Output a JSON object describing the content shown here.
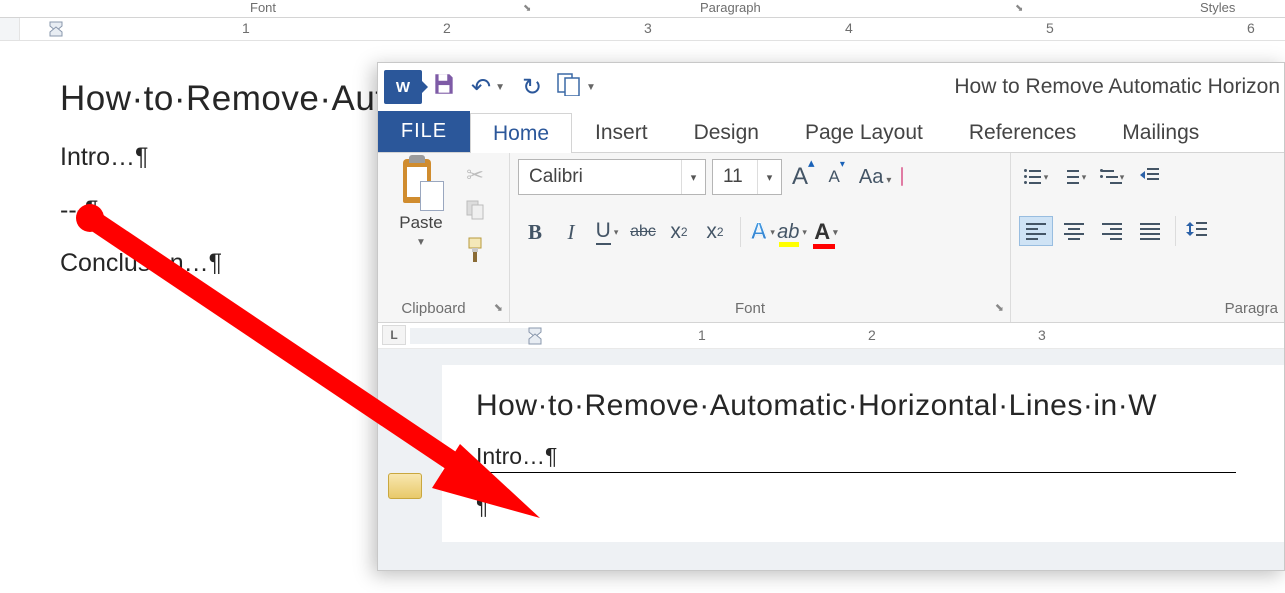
{
  "bg": {
    "groups": {
      "font": "Font",
      "paragraph": "Paragraph",
      "styles": "Styles",
      "launcher": "⬊"
    },
    "ruler": {
      "n1": "1",
      "n2": "2",
      "n3": "3",
      "n4": "4",
      "n5": "5",
      "n6": "6"
    },
    "doc": {
      "title": "How·to·Remove·Auto",
      "intro": "Intro…¶",
      "dashes": "---¶",
      "conclusion": "Conclusion…¶"
    }
  },
  "fg": {
    "qat": {
      "word_badge": "W",
      "save": "💾",
      "undo": "↶",
      "redo": "↻",
      "newdoc": "🗐",
      "title": "How to Remove Automatic Horizon"
    },
    "tabs": {
      "file": "FILE",
      "home": "Home",
      "insert": "Insert",
      "design": "Design",
      "page_layout": "Page Layout",
      "references": "References",
      "mailings": "Mailings"
    },
    "clipboard": {
      "paste": "Paste",
      "label": "Clipboard",
      "cut": "✂",
      "copy_icon": "⧉",
      "painter": "🖌"
    },
    "font": {
      "name": "Calibri",
      "size": "11",
      "grow": "A",
      "shrink": "A",
      "case": "Aa",
      "clear_icon": "eraser",
      "bold": "B",
      "italic": "I",
      "underline": "U",
      "strike": "abc",
      "sub": "x",
      "sub2": "2",
      "sup": "x",
      "sup2": "2",
      "effects": "A",
      "highlight_pen": "ab",
      "color": "A",
      "label": "Font"
    },
    "paragraph": {
      "label": "Paragra",
      "bullets": "bullets",
      "numbering": "numbering",
      "multilevel": "multilevel",
      "dec_indent": "⇤",
      "inc_indent": "⇥",
      "align_left": "al",
      "align_center": "ac",
      "align_right": "ar",
      "justify": "aj",
      "spacing": "‡≡"
    },
    "ruler": {
      "tabwell": "L",
      "n1": "1",
      "n2": "2",
      "n3": "3"
    },
    "doc": {
      "title": "How·to·Remove·Automatic·Horizontal·Lines·in·W",
      "intro": "Intro…¶",
      "para_mark": " ¶"
    }
  }
}
